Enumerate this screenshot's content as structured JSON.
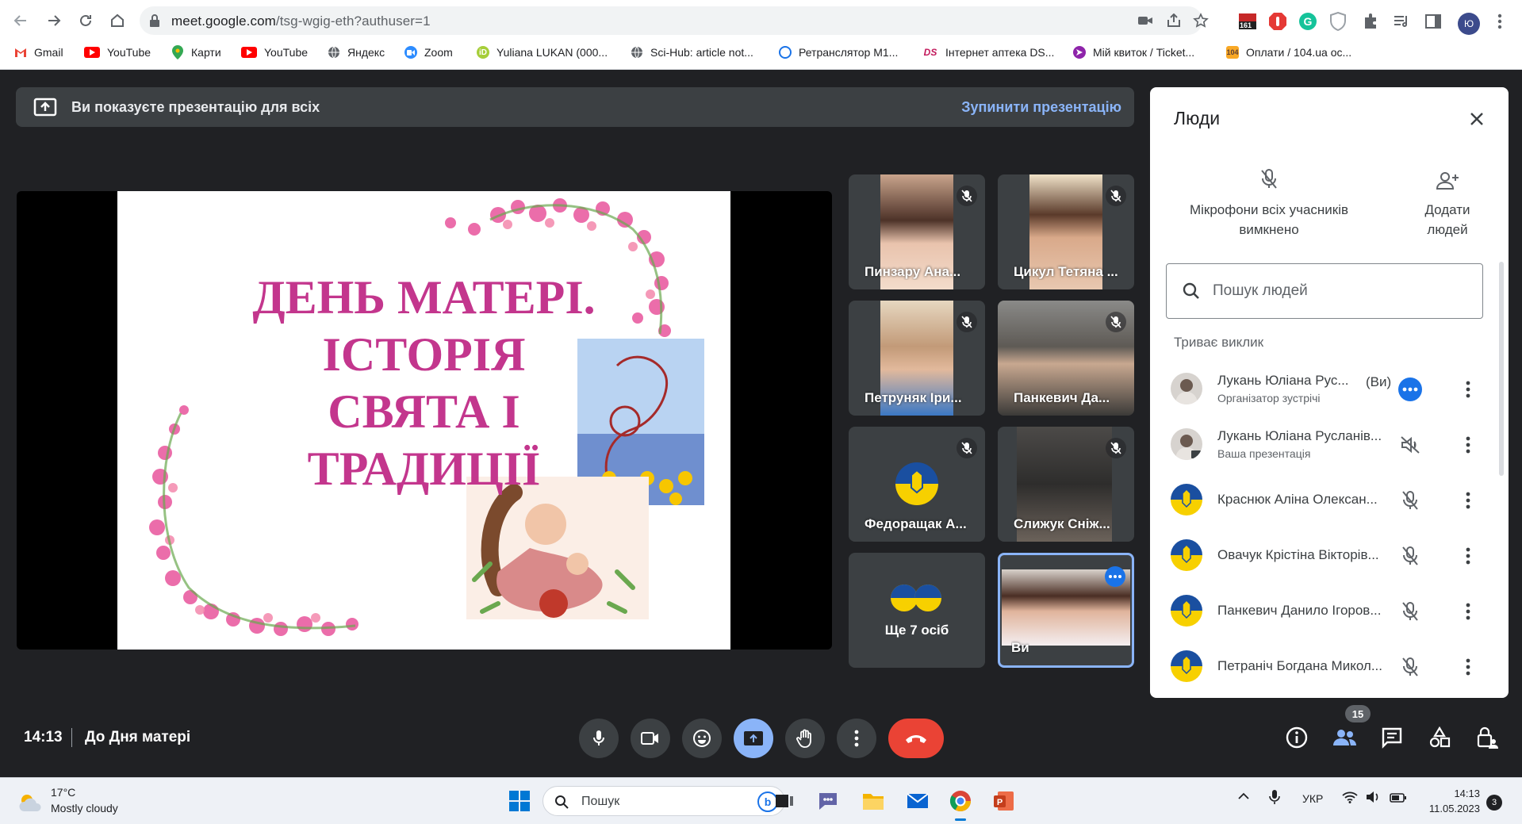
{
  "browser": {
    "url_host": "meet.google.com",
    "url_path": "/tsg-wgig-eth?authuser=1",
    "profile_initial": "Ю",
    "ext_badge": "161",
    "bookmarks": [
      {
        "label": "Gmail",
        "icon": "gmail-icon",
        "color": "#ea4335"
      },
      {
        "label": "YouTube",
        "icon": "youtube-icon",
        "color": "#ff0000"
      },
      {
        "label": "Карти",
        "icon": "maps-icon",
        "color": "#34a853"
      },
      {
        "label": "YouTube",
        "icon": "youtube-icon",
        "color": "#ff0000"
      },
      {
        "label": "Яндекс",
        "icon": "globe-icon",
        "color": "#5f6368"
      },
      {
        "label": "Zoom",
        "icon": "zoom-icon",
        "color": "#2d8cff"
      },
      {
        "label": "Yuliana LUKAN (000...",
        "icon": "orcid-icon",
        "color": "#a6ce39"
      },
      {
        "label": "Sci-Hub: article not...",
        "icon": "globe-icon",
        "color": "#5f6368"
      },
      {
        "label": "Ретранслятор М1...",
        "icon": "broadcast-icon",
        "color": "#1a73e8"
      },
      {
        "label": "Інтернет аптека DS...",
        "icon": "ds-icon",
        "color": "#c2185b"
      },
      {
        "label": "Мій квиток / Ticket...",
        "icon": "ticket-icon",
        "color": "#8e24aa"
      },
      {
        "label": "Оплати / 104.ua ос...",
        "icon": "gas-icon",
        "color": "#f9a825"
      }
    ]
  },
  "meet": {
    "banner_text": "Ви показуєте презентацію для всіх",
    "stop_label": "Зупинити презентацію",
    "slide": {
      "line1": "ДЕНЬ МАТЕРІ.",
      "line2": "ІСТОРІЯ",
      "line3": "СВЯТА І",
      "line4": "ТРАДИЦІЇ"
    },
    "tiles": [
      {
        "name": "Пинзару Ана..."
      },
      {
        "name": "Цикул Тетяна ..."
      },
      {
        "name": "Петруняк Іри..."
      },
      {
        "name": "Панкевич Да..."
      },
      {
        "name": "Федоращак А..."
      },
      {
        "name": "Слижук Сніж..."
      },
      {
        "name": "Ще 7 осіб"
      },
      {
        "name": "Ви"
      }
    ],
    "time": "14:13",
    "meeting_title": "До Дня матері",
    "participants_count": "15"
  },
  "people": {
    "title": "Люди",
    "mute_all": "Мікрофони всіх учасників вимкнено",
    "add_people": "Додати людей",
    "search_placeholder": "Пошук людей",
    "section": "Триває виклик",
    "list": [
      {
        "name": "Лукань Юліана Рус...",
        "you": "(Ви)",
        "role": "Організатор зустрічі"
      },
      {
        "name": "Лукань Юліана Русланів...",
        "role": "Ваша презентація"
      },
      {
        "name": "Краснюк Аліна Олексан..."
      },
      {
        "name": "Овачук Крістіна Вікторів..."
      },
      {
        "name": "Панкевич Данило Ігоров..."
      },
      {
        "name": "Петраніч Богдана Микол..."
      }
    ]
  },
  "taskbar": {
    "temp": "17°C",
    "condition": "Mostly cloudy",
    "search": "Пошук",
    "lang": "УКР",
    "time": "14:13",
    "date": "11.05.2023",
    "notifications": "3"
  }
}
